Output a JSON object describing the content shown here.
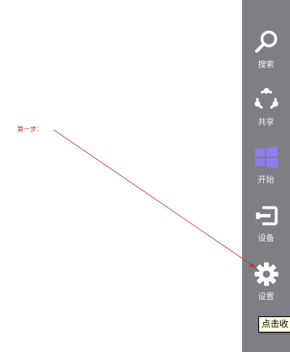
{
  "annotation": {
    "step_label": "第一步：",
    "color": "#c0392b"
  },
  "charms_bar": {
    "background": "#7f7e85",
    "items": [
      {
        "label": "搜索",
        "icon": "search-icon"
      },
      {
        "label": "共享",
        "icon": "share-icon"
      },
      {
        "label": "开始",
        "icon": "windows-start-icon",
        "icon_color": "#8e7cf0"
      },
      {
        "label": "设备",
        "icon": "devices-icon"
      },
      {
        "label": "设置",
        "icon": "settings-icon"
      }
    ]
  },
  "tooltip": {
    "text": "点击收"
  }
}
